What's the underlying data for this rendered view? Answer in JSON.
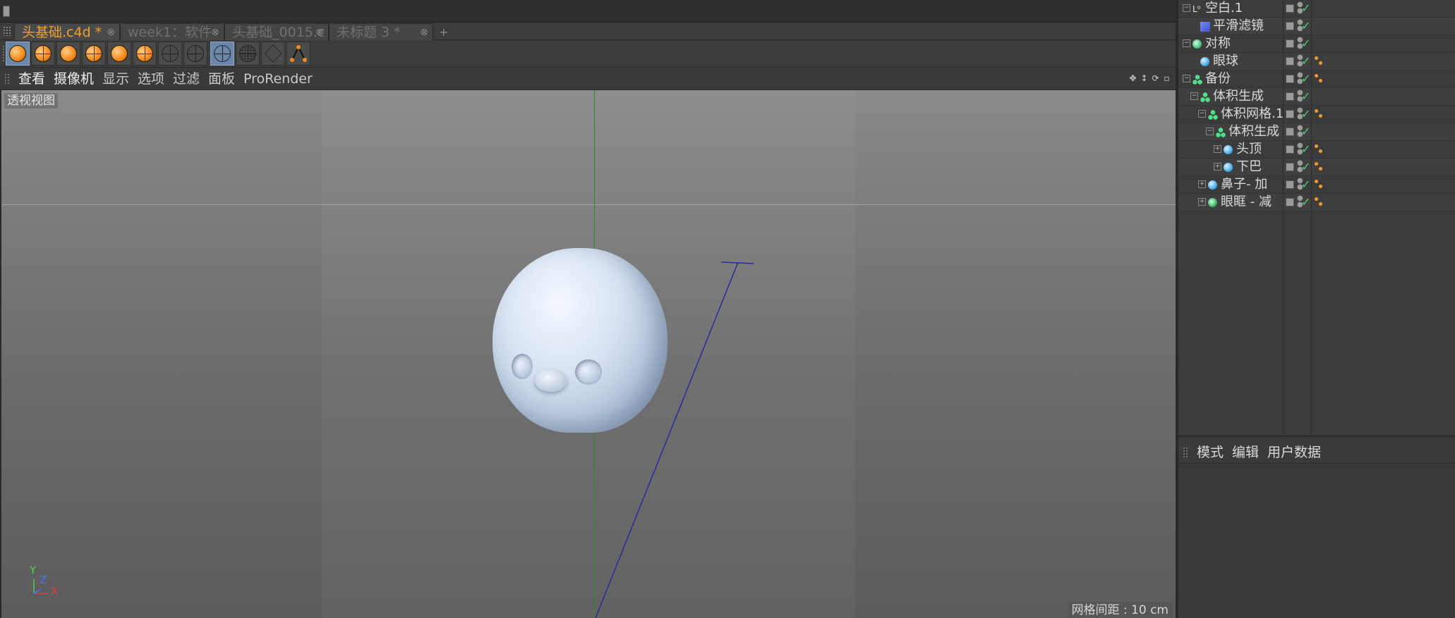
{
  "document_tabs": [
    {
      "label": "头基础.c4d *",
      "active": true
    },
    {
      "label": "week1：软件",
      "active": false
    },
    {
      "label": "头基础_0015.c",
      "active": false
    },
    {
      "label": "未标题 3 *",
      "active": false
    }
  ],
  "tab_add_label": "+",
  "tab_close_glyph": "⊗",
  "toolbar_icons": [
    "render-view-icon",
    "render-region-icon",
    "render-active-icon",
    "render-picture-viewer-icon",
    "edit-render-settings-icon",
    "render-settings-icon",
    "wireframe-sphere-icon",
    "wireframe-grid-icon",
    "display-mode-icon",
    "isoparm-icon",
    "box-display-icon",
    "deformer-icon"
  ],
  "viewport_menu": {
    "items": [
      "查看",
      "摄像机",
      "显示",
      "选项",
      "过滤",
      "面板",
      "ProRender"
    ]
  },
  "viewport": {
    "label": "透视视图",
    "grid_spacing": "网格间距 : 10 cm",
    "axis_labels": {
      "y": "Y",
      "z": "Z",
      "x": "X"
    }
  },
  "object_tree": [
    {
      "name": "空白.1",
      "icon": "null-icon",
      "depth": 0,
      "expander": "⊖",
      "tag": false
    },
    {
      "name": "平滑滤镜",
      "icon": "smoothing-filter-icon",
      "depth": 1,
      "expander": "",
      "tag": false
    },
    {
      "name": "对称",
      "icon": "symmetry-icon",
      "depth": 0,
      "expander": "⊖",
      "tag": false
    },
    {
      "name": "眼球",
      "icon": "sphere-icon",
      "depth": 1,
      "expander": "",
      "tag": true
    },
    {
      "name": "备份",
      "icon": "volume-icon",
      "depth": 0,
      "expander": "⊖",
      "tag": true
    },
    {
      "name": "体积生成",
      "icon": "volume-icon",
      "depth": 1,
      "expander": "⊖",
      "tag": false
    },
    {
      "name": "体积网格.1",
      "icon": "volume-icon",
      "depth": 2,
      "expander": "⊖",
      "tag": true
    },
    {
      "name": "体积生成",
      "icon": "volume-icon",
      "depth": 3,
      "expander": "⊖",
      "tag": false
    },
    {
      "name": "头顶",
      "icon": "sphere-icon",
      "depth": 4,
      "expander": "⊕",
      "tag": true
    },
    {
      "name": "下巴",
      "icon": "sphere-icon",
      "depth": 4,
      "expander": "⊕",
      "tag": true
    },
    {
      "name": "鼻子- 加",
      "icon": "sphere-icon",
      "depth": 2,
      "expander": "⊕",
      "tag": true
    },
    {
      "name": "眼眶 - 减",
      "icon": "subtract-icon",
      "depth": 2,
      "expander": "⊕",
      "tag": true
    }
  ],
  "attribute_manager": {
    "tabs": [
      "模式",
      "编辑",
      "用户数据"
    ]
  },
  "colors": {
    "active_tab": "#f0a030",
    "y_axis": "#2f8a2f",
    "camera_line": "#2a2aa0",
    "head_surface": "#cfdbeb",
    "tag_orange": "#f29a2e"
  }
}
